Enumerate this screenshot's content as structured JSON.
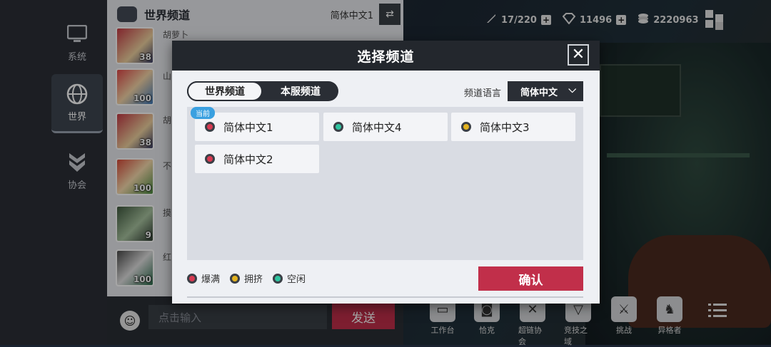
{
  "colors": {
    "full": "#d83a52",
    "crowded": "#e2b21f",
    "idle": "#2fc4a0",
    "accent": "#c12f4a"
  },
  "nav": [
    {
      "label": "系统",
      "icon": "monitor-icon"
    },
    {
      "label": "世界",
      "icon": "globe-icon"
    },
    {
      "label": "协会",
      "icon": "guild-emblem-icon"
    }
  ],
  "chat": {
    "title": "世界频道",
    "channel": "简体中文1",
    "swap_icon": "swap-icon",
    "messages": [
      {
        "name": "胡萝卜",
        "level": "38"
      },
      {
        "name": "山",
        "level": "100"
      },
      {
        "name": "胡",
        "level": "38"
      },
      {
        "name": "不",
        "level": "100"
      },
      {
        "name": "摸",
        "level": "9"
      },
      {
        "name": "红",
        "level": "100"
      }
    ],
    "input_placeholder": "点击输入",
    "send_label": "发送"
  },
  "resources": [
    {
      "icon": "stamina-icon",
      "value": "17/220"
    },
    {
      "icon": "diamond-icon",
      "value": "11496"
    },
    {
      "icon": "coin-icon",
      "value": "2220963"
    }
  ],
  "bottom_menu": [
    {
      "label": "工作台",
      "icon": "workbench-icon"
    },
    {
      "label": "恰克",
      "icon": "chuck-icon"
    },
    {
      "label": "超链协会",
      "icon": "guild-icon"
    },
    {
      "label": "竞技之域",
      "icon": "arena-icon"
    },
    {
      "label": "挑战",
      "icon": "challenge-icon"
    },
    {
      "label": "异格者",
      "icon": "character-icon"
    }
  ],
  "modal": {
    "title": "选择频道",
    "tabs": [
      "世界频道",
      "本服频道"
    ],
    "lang_label": "频道语言",
    "lang_value": "简体中文",
    "current_badge": "当前",
    "channels": [
      {
        "name": "简体中文1",
        "status": "full"
      },
      {
        "name": "简体中文4",
        "status": "idle"
      },
      {
        "name": "简体中文3",
        "status": "crowded"
      },
      {
        "name": "简体中文2",
        "status": "full"
      }
    ],
    "legend": [
      {
        "label": "爆满",
        "status": "full"
      },
      {
        "label": "拥挤",
        "status": "crowded"
      },
      {
        "label": "空闲",
        "status": "idle"
      }
    ],
    "confirm_label": "确认"
  }
}
